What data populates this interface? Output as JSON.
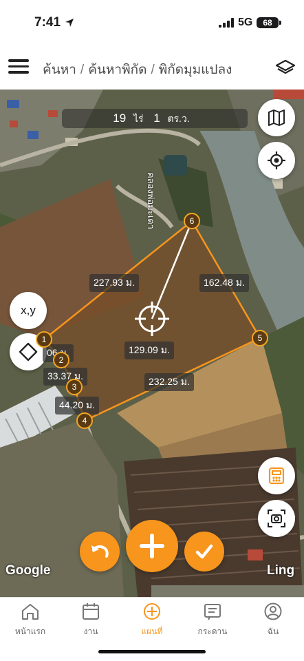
{
  "status_bar": {
    "time": "7:41",
    "network": "5G",
    "battery": "68"
  },
  "header": {
    "breadcrumb": [
      "ค้นหา",
      "ค้นหาพิกัด",
      "พิกัดมุมแปลง"
    ],
    "separator": "/"
  },
  "map": {
    "area": {
      "rai_value": "19",
      "rai_unit": "ไร่",
      "wah_value": "1",
      "wah_unit": "ตร.ว."
    },
    "canal_label": "คลองพ่อมะเดา",
    "radius_label": "129.09 ม.",
    "distances": [
      "227.93 ม.",
      "162.48 ม.",
      "232.25 ม.",
      "44.20 ม.",
      "33.37 ม.",
      "06 ม."
    ],
    "vertices": [
      "1",
      "2",
      "3",
      "4",
      "5",
      "6"
    ],
    "coord_button": "x,y",
    "attribution_left": "Google",
    "attribution_right": "Ling",
    "accent_color": "#f7951d"
  },
  "tabs": [
    {
      "label": "หน้าแรก",
      "icon": "home-icon",
      "active": false
    },
    {
      "label": "งาน",
      "icon": "calendar-icon",
      "active": false
    },
    {
      "label": "แผนที่",
      "icon": "map-plus-icon",
      "active": true
    },
    {
      "label": "กระดาน",
      "icon": "board-icon",
      "active": false
    },
    {
      "label": "ฉัน",
      "icon": "profile-icon",
      "active": false
    }
  ]
}
